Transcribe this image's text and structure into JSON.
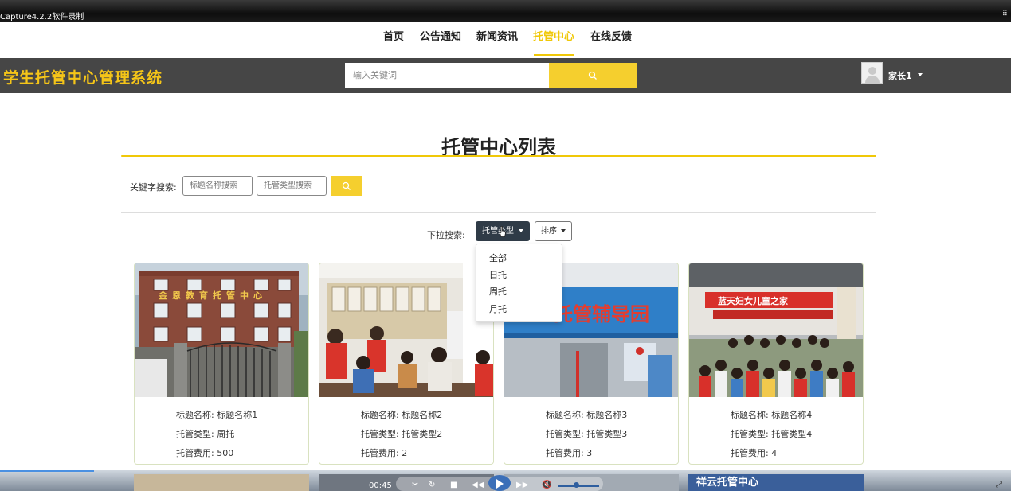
{
  "window": {
    "title": "Capture4.2.2软件录制"
  },
  "topnav": {
    "items": [
      {
        "label": "首页"
      },
      {
        "label": "公告通知"
      },
      {
        "label": "新闻资讯"
      },
      {
        "label": "托管中心",
        "active": true
      },
      {
        "label": "在线反馈"
      }
    ]
  },
  "header": {
    "logo": "学生托管中心管理系统",
    "search_placeholder": "输入关键词",
    "username": "家长1"
  },
  "page": {
    "title": "托管中心列表",
    "keyword_label": "关键字搜索:",
    "title_search_placeholder": "标题名称搜索",
    "type_search_placeholder": "托管类型搜索",
    "dropdown_label": "下拉搜索:",
    "type_dropdown_label": "托管类型",
    "sort_dropdown_label": "排序",
    "type_options": [
      "全部",
      "日托",
      "周托",
      "月托"
    ]
  },
  "cards": [
    {
      "name_label": "标题名称:",
      "name": "标题名称1",
      "type_label": "托管类型:",
      "type": "周托",
      "fee_label": "托管费用:",
      "fee": "500",
      "image_text": "金恩教育托管中心"
    },
    {
      "name_label": "标题名称:",
      "name": "标题名称2",
      "type_label": "托管类型:",
      "type": "托管类型2",
      "fee_label": "托管费用:",
      "fee": "2",
      "image_text": ""
    },
    {
      "name_label": "标题名称:",
      "name": "标题名称3",
      "type_label": "托管类型:",
      "type": "托管类型3",
      "fee_label": "托管费用:",
      "fee": "3",
      "image_text": "托管辅导园"
    },
    {
      "name_label": "标题名称:",
      "name": "标题名称4",
      "type_label": "托管类型:",
      "type": "托管类型4",
      "fee_label": "托管费用:",
      "fee": "4",
      "image_text": "蓝天妇女儿童之家"
    }
  ],
  "player": {
    "time": "00:45",
    "next_row_image_text": "祥云托管中心"
  },
  "colors": {
    "accent": "#f0c808",
    "header_bg": "#464646",
    "dropdown_bg": "#2f3b47"
  }
}
